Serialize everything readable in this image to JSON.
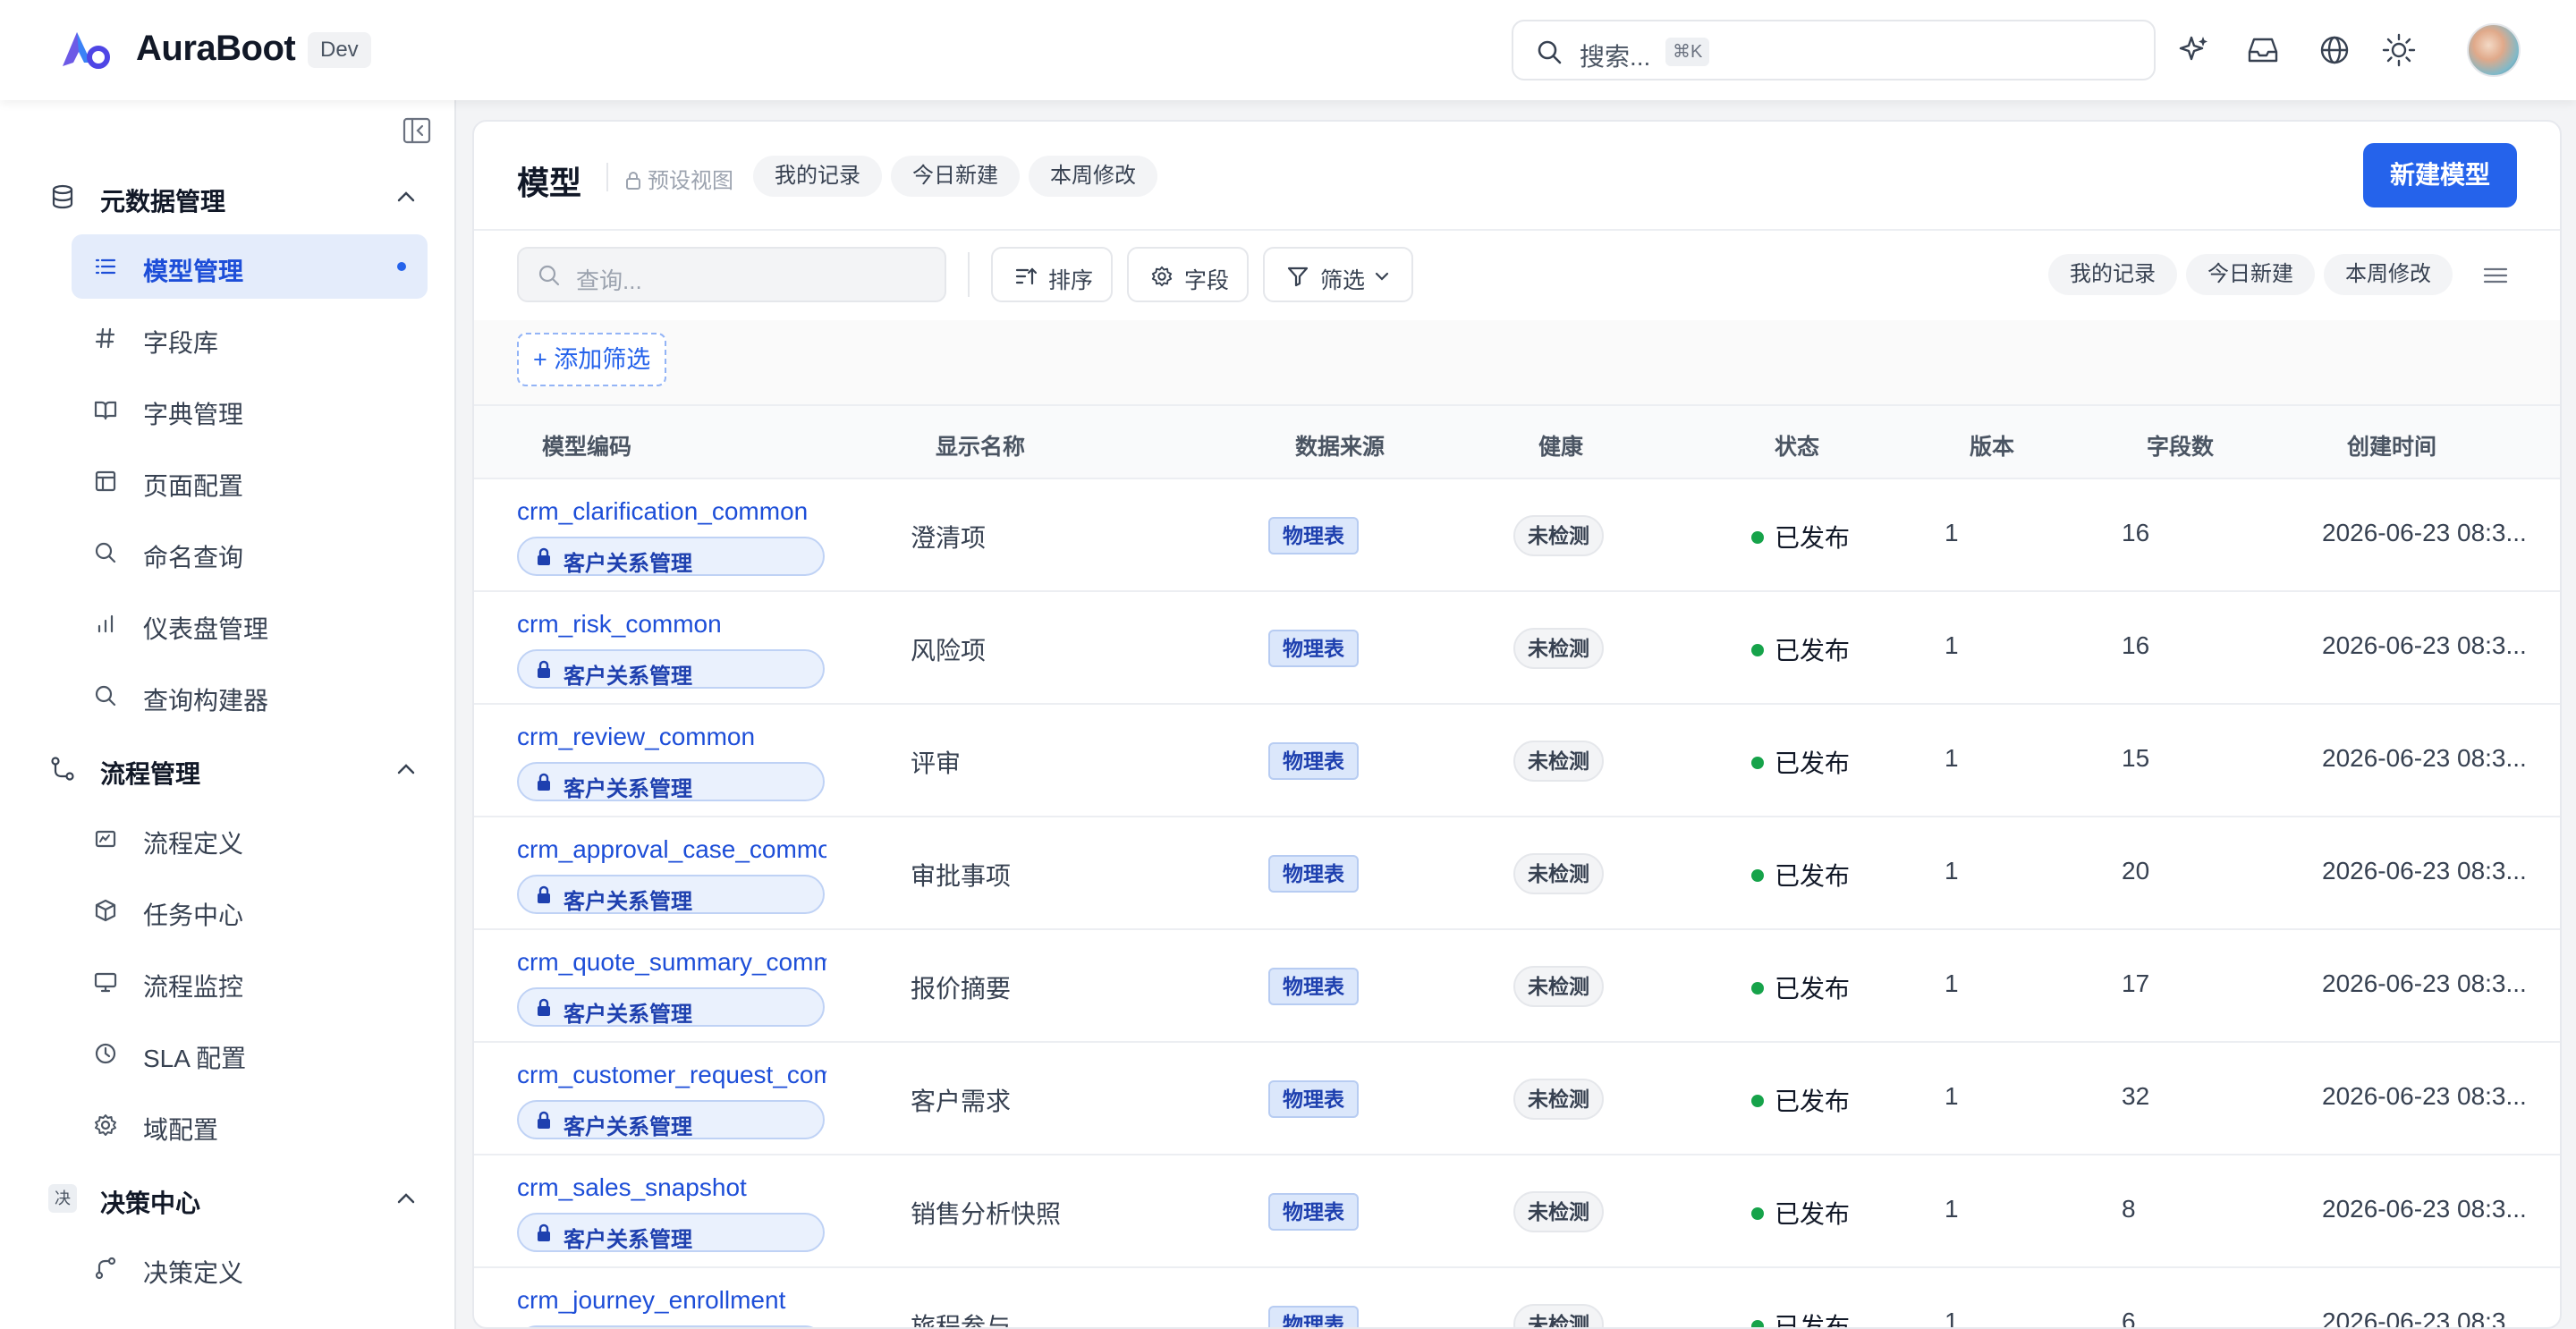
{
  "app": {
    "name": "AuraBoot",
    "env": "Dev"
  },
  "search": {
    "placeholder": "搜索...",
    "shortcut": "⌘K"
  },
  "header_icons": [
    "sparkle-icon",
    "inbox-icon",
    "globe-icon",
    "sun-icon"
  ],
  "sidebar": {
    "groups": [
      {
        "label": "元数据管理",
        "icon": "database-icon"
      },
      {
        "label": "流程管理",
        "icon": "workflow-icon"
      },
      {
        "label": "决策中心",
        "icon": "decision-icon",
        "badge": "决"
      }
    ],
    "items": [
      {
        "label": "模型管理",
        "icon": "list-icon",
        "active": true
      },
      {
        "label": "字段库",
        "icon": "hash-icon"
      },
      {
        "label": "字典管理",
        "icon": "book-icon"
      },
      {
        "label": "页面配置",
        "icon": "layout-icon"
      },
      {
        "label": "命名查询",
        "icon": "search-icon"
      },
      {
        "label": "仪表盘管理",
        "icon": "bar-chart-icon"
      },
      {
        "label": "查询构建器",
        "icon": "search-icon"
      },
      {
        "label": "流程定义",
        "icon": "flow-icon"
      },
      {
        "label": "任务中心",
        "icon": "box-icon"
      },
      {
        "label": "流程监控",
        "icon": "monitor-icon"
      },
      {
        "label": "SLA 配置",
        "icon": "clock-icon"
      },
      {
        "label": "域配置",
        "icon": "gear-icon"
      },
      {
        "label": "决策定义",
        "icon": "branch-icon"
      }
    ]
  },
  "page": {
    "title": "模型",
    "preset_label": "预设视图",
    "view_chips": [
      "我的记录",
      "今日新建",
      "本周修改"
    ],
    "new_button": "新建模型",
    "query_placeholder": "查询...",
    "toolbar": {
      "sort": "排序",
      "fields": "字段",
      "filter": "筛选"
    },
    "add_filter": "+ 添加筛选"
  },
  "table": {
    "columns": [
      "模型编码",
      "显示名称",
      "数据来源",
      "健康",
      "状态",
      "版本",
      "字段数",
      "创建时间"
    ],
    "rows": [
      {
        "code": "crm_clarification_common",
        "domain": "客户关系管理",
        "name": "澄清项",
        "source": "物理表",
        "health": "未检测",
        "status": "已发布",
        "version": "1",
        "fields": "16",
        "created": "2026-06-23 08:3..."
      },
      {
        "code": "crm_risk_common",
        "domain": "客户关系管理",
        "name": "风险项",
        "source": "物理表",
        "health": "未检测",
        "status": "已发布",
        "version": "1",
        "fields": "16",
        "created": "2026-06-23 08:3..."
      },
      {
        "code": "crm_review_common",
        "domain": "客户关系管理",
        "name": "评审",
        "source": "物理表",
        "health": "未检测",
        "status": "已发布",
        "version": "1",
        "fields": "15",
        "created": "2026-06-23 08:3..."
      },
      {
        "code": "crm_approval_case_common",
        "domain": "客户关系管理",
        "name": "审批事项",
        "source": "物理表",
        "health": "未检测",
        "status": "已发布",
        "version": "1",
        "fields": "20",
        "created": "2026-06-23 08:3..."
      },
      {
        "code": "crm_quote_summary_common",
        "domain": "客户关系管理",
        "name": "报价摘要",
        "source": "物理表",
        "health": "未检测",
        "status": "已发布",
        "version": "1",
        "fields": "17",
        "created": "2026-06-23 08:3..."
      },
      {
        "code": "crm_customer_request_common",
        "domain": "客户关系管理",
        "name": "客户需求",
        "source": "物理表",
        "health": "未检测",
        "status": "已发布",
        "version": "1",
        "fields": "32",
        "created": "2026-06-23 08:3..."
      },
      {
        "code": "crm_sales_snapshot",
        "domain": "客户关系管理",
        "name": "销售分析快照",
        "source": "物理表",
        "health": "未检测",
        "status": "已发布",
        "version": "1",
        "fields": "8",
        "created": "2026-06-23 08:3..."
      },
      {
        "code": "crm_journey_enrollment",
        "domain": "客户关系管理",
        "name": "旅程参与",
        "source": "物理表",
        "health": "未检测",
        "status": "已发布",
        "version": "1",
        "fields": "6",
        "created": "2026-06-23 08:3..."
      }
    ]
  }
}
